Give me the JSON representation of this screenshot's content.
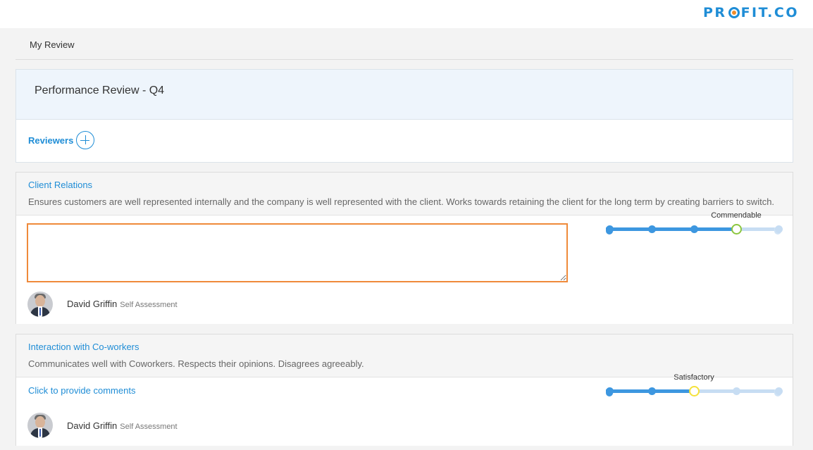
{
  "brand": {
    "logo_pre": "PR",
    "logo_post": "FIT.CO"
  },
  "breadcrumb": "My Review",
  "review": {
    "title": "Performance Review - Q4",
    "reviewers_label": "Reviewers"
  },
  "competencies": [
    {
      "title": "Client Relations",
      "description": "Ensures customers are well represented internally and the company is well represented with the client. Works towards retaining the client for the long term by creating barriers to switch.",
      "comment": "",
      "assessor_name": "David Griffin",
      "assessor_role": "Self Assessment",
      "rating_label": "Commendable",
      "rating_value": 4,
      "rating_max": 5,
      "handle_color": "#8cc63f"
    },
    {
      "title": "Interaction with Co-workers",
      "description": "Communicates well with Coworkers. Respects their opinions. Disagrees agreeably.",
      "comment_prompt": "Click to provide comments",
      "assessor_name": "David Griffin",
      "assessor_role": "Self Assessment",
      "rating_label": "Satisfactory",
      "rating_value": 3,
      "rating_max": 5,
      "handle_color": "#f5e23a"
    }
  ],
  "icons": {
    "add_reviewer": "plus-circle-icon",
    "avatar": "user-photo"
  }
}
